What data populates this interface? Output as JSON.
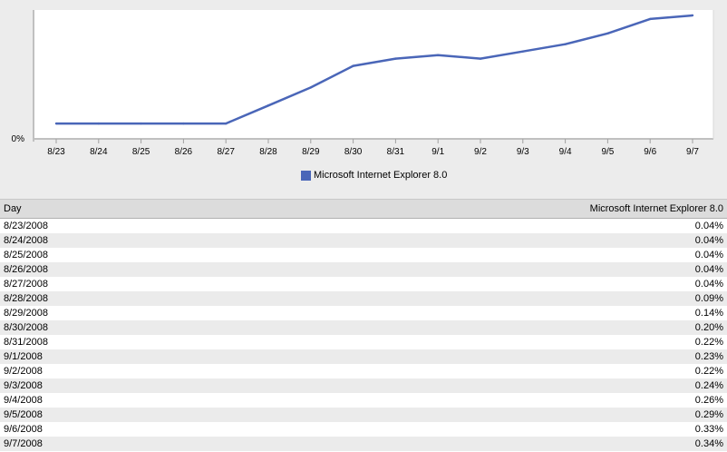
{
  "chart_data": {
    "type": "line",
    "categories": [
      "8/23",
      "8/24",
      "8/25",
      "8/26",
      "8/27",
      "8/28",
      "8/29",
      "8/30",
      "8/31",
      "9/1",
      "9/2",
      "9/3",
      "9/4",
      "9/5",
      "9/6",
      "9/7"
    ],
    "series": [
      {
        "name": "Microsoft Internet Explorer 8.0",
        "color": "#4a66b8",
        "values": [
          0.04,
          0.04,
          0.04,
          0.04,
          0.04,
          0.09,
          0.14,
          0.2,
          0.22,
          0.23,
          0.22,
          0.24,
          0.26,
          0.29,
          0.33,
          0.34
        ]
      }
    ],
    "y_tick_labels": [
      "0%"
    ],
    "ylim": [
      0.0,
      0.35
    ],
    "grid": false,
    "legend_position": "bottom-center"
  },
  "legend": {
    "label": "Microsoft Internet Explorer 8.0",
    "color": "#4a66b8"
  },
  "table": {
    "headers": {
      "day": "Day",
      "value": "Microsoft Internet Explorer 8.0"
    },
    "rows": [
      {
        "day": "8/23/2008",
        "value": "0.04%"
      },
      {
        "day": "8/24/2008",
        "value": "0.04%"
      },
      {
        "day": "8/25/2008",
        "value": "0.04%"
      },
      {
        "day": "8/26/2008",
        "value": "0.04%"
      },
      {
        "day": "8/27/2008",
        "value": "0.04%"
      },
      {
        "day": "8/28/2008",
        "value": "0.09%"
      },
      {
        "day": "8/29/2008",
        "value": "0.14%"
      },
      {
        "day": "8/30/2008",
        "value": "0.20%"
      },
      {
        "day": "8/31/2008",
        "value": "0.22%"
      },
      {
        "day": "9/1/2008",
        "value": "0.23%"
      },
      {
        "day": "9/2/2008",
        "value": "0.22%"
      },
      {
        "day": "9/3/2008",
        "value": "0.24%"
      },
      {
        "day": "9/4/2008",
        "value": "0.26%"
      },
      {
        "day": "9/5/2008",
        "value": "0.29%"
      },
      {
        "day": "9/6/2008",
        "value": "0.33%"
      },
      {
        "day": "9/7/2008",
        "value": "0.34%"
      }
    ]
  }
}
